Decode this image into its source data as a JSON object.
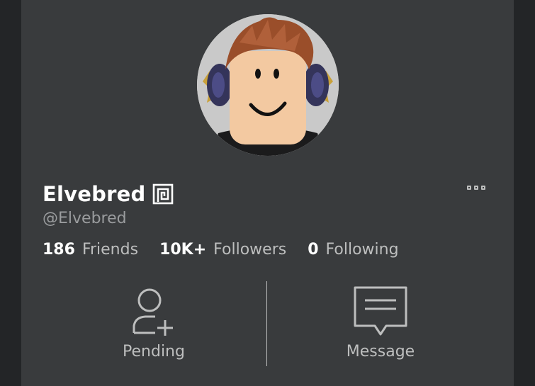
{
  "profile": {
    "display_name": "Elvebred",
    "username": "@Elvebred",
    "verified_icon": "verified-badge-icon",
    "more_icon": "more-options-icon"
  },
  "stats": [
    {
      "value": "186",
      "label": "Friends"
    },
    {
      "value": "10K+",
      "label": "Followers"
    },
    {
      "value": "0",
      "label": "Following"
    }
  ],
  "actions": {
    "pending_label": "Pending",
    "pending_icon": "add-friend-icon",
    "message_label": "Message",
    "message_icon": "message-icon"
  },
  "colors": {
    "background": "#232527",
    "panel": "#393b3d",
    "text_primary": "#ffffff",
    "text_secondary": "#bdbebe",
    "text_muted": "#9a9c9e"
  }
}
